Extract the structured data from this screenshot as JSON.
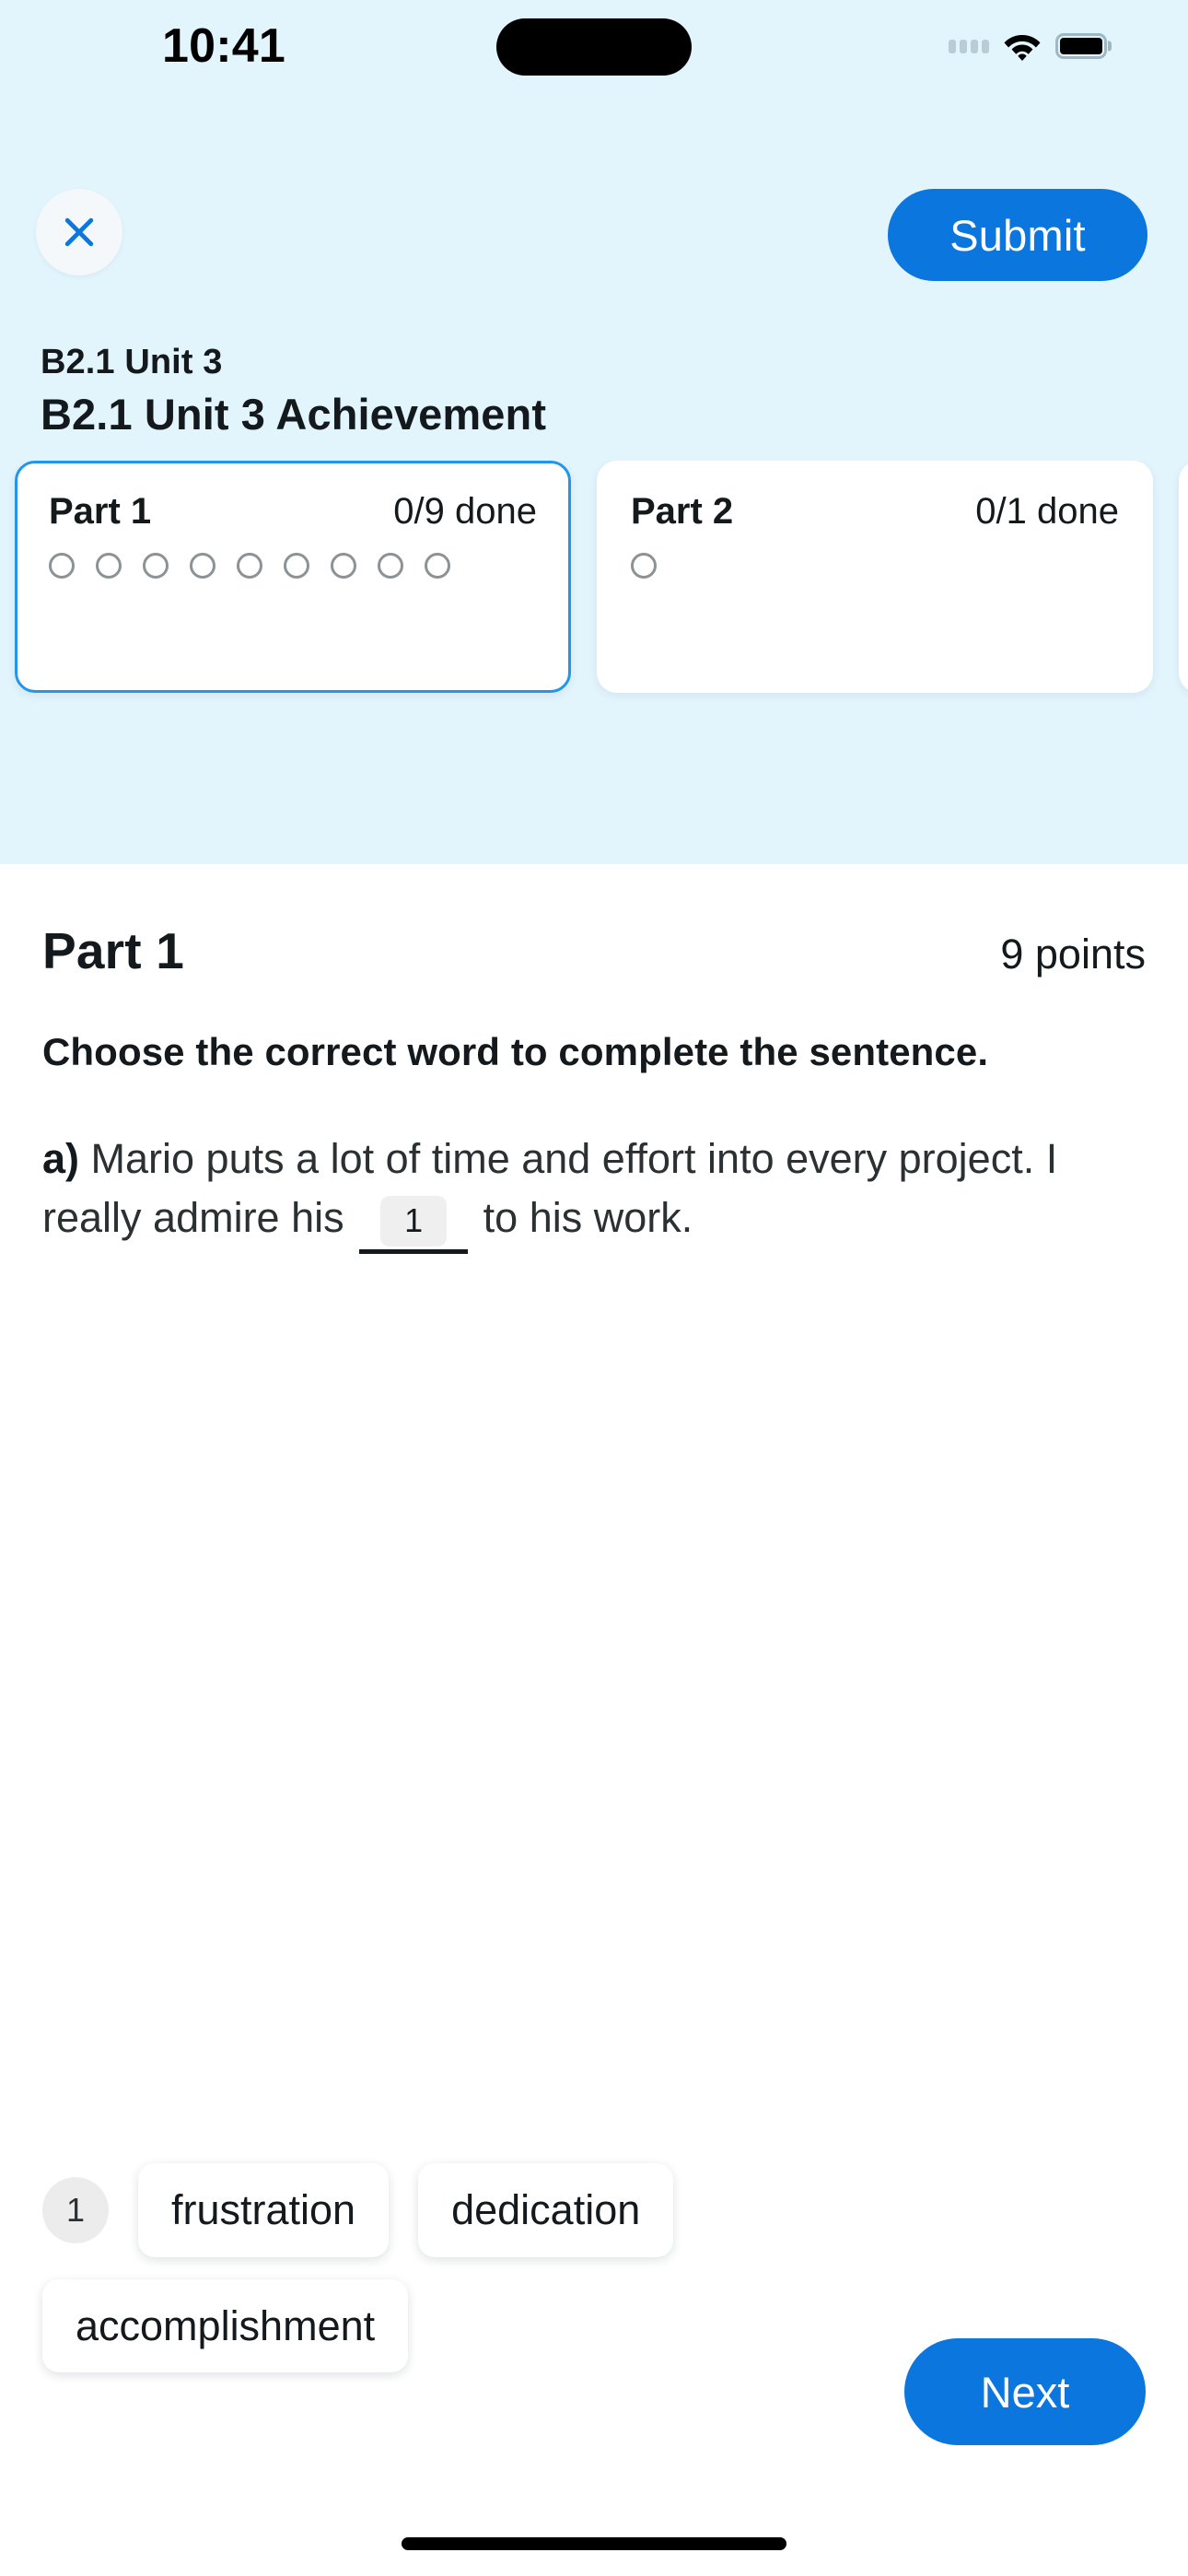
{
  "status_bar": {
    "time": "10:41",
    "signal_icon": "signal-dots-icon",
    "wifi_icon": "wifi-icon",
    "battery_icon": "battery-icon"
  },
  "top_bar": {
    "close_icon": "close-icon",
    "submit_label": "Submit"
  },
  "lesson": {
    "subtitle": "B2.1 Unit 3",
    "title": "B2.1 Unit 3 Achievement"
  },
  "part_cards": [
    {
      "title": "Part 1",
      "done": "0/9 done",
      "question_count": 9,
      "active": true
    },
    {
      "title": "Part 2",
      "done": "0/1 done",
      "question_count": 1,
      "active": false
    },
    {
      "title": "",
      "done": "",
      "question_count": 0,
      "active": false
    }
  ],
  "main": {
    "part_title": "Part 1",
    "points": "9 points",
    "instruction": "Choose the correct word to complete the sentence.",
    "question": {
      "label": "a)",
      "text_before": "Mario puts a lot of time and effort into every project. I really admire his",
      "blank_number": "1",
      "text_after": "to his work."
    },
    "slot_badge": "1",
    "options": [
      "frustration",
      "dedication",
      "accomplishment"
    ],
    "next_label": "Next"
  },
  "colors": {
    "accent_blue": "#0b77de",
    "header_bg": "#e2f4fc",
    "active_border": "#2196ec",
    "chip_bg": "#ececec"
  }
}
